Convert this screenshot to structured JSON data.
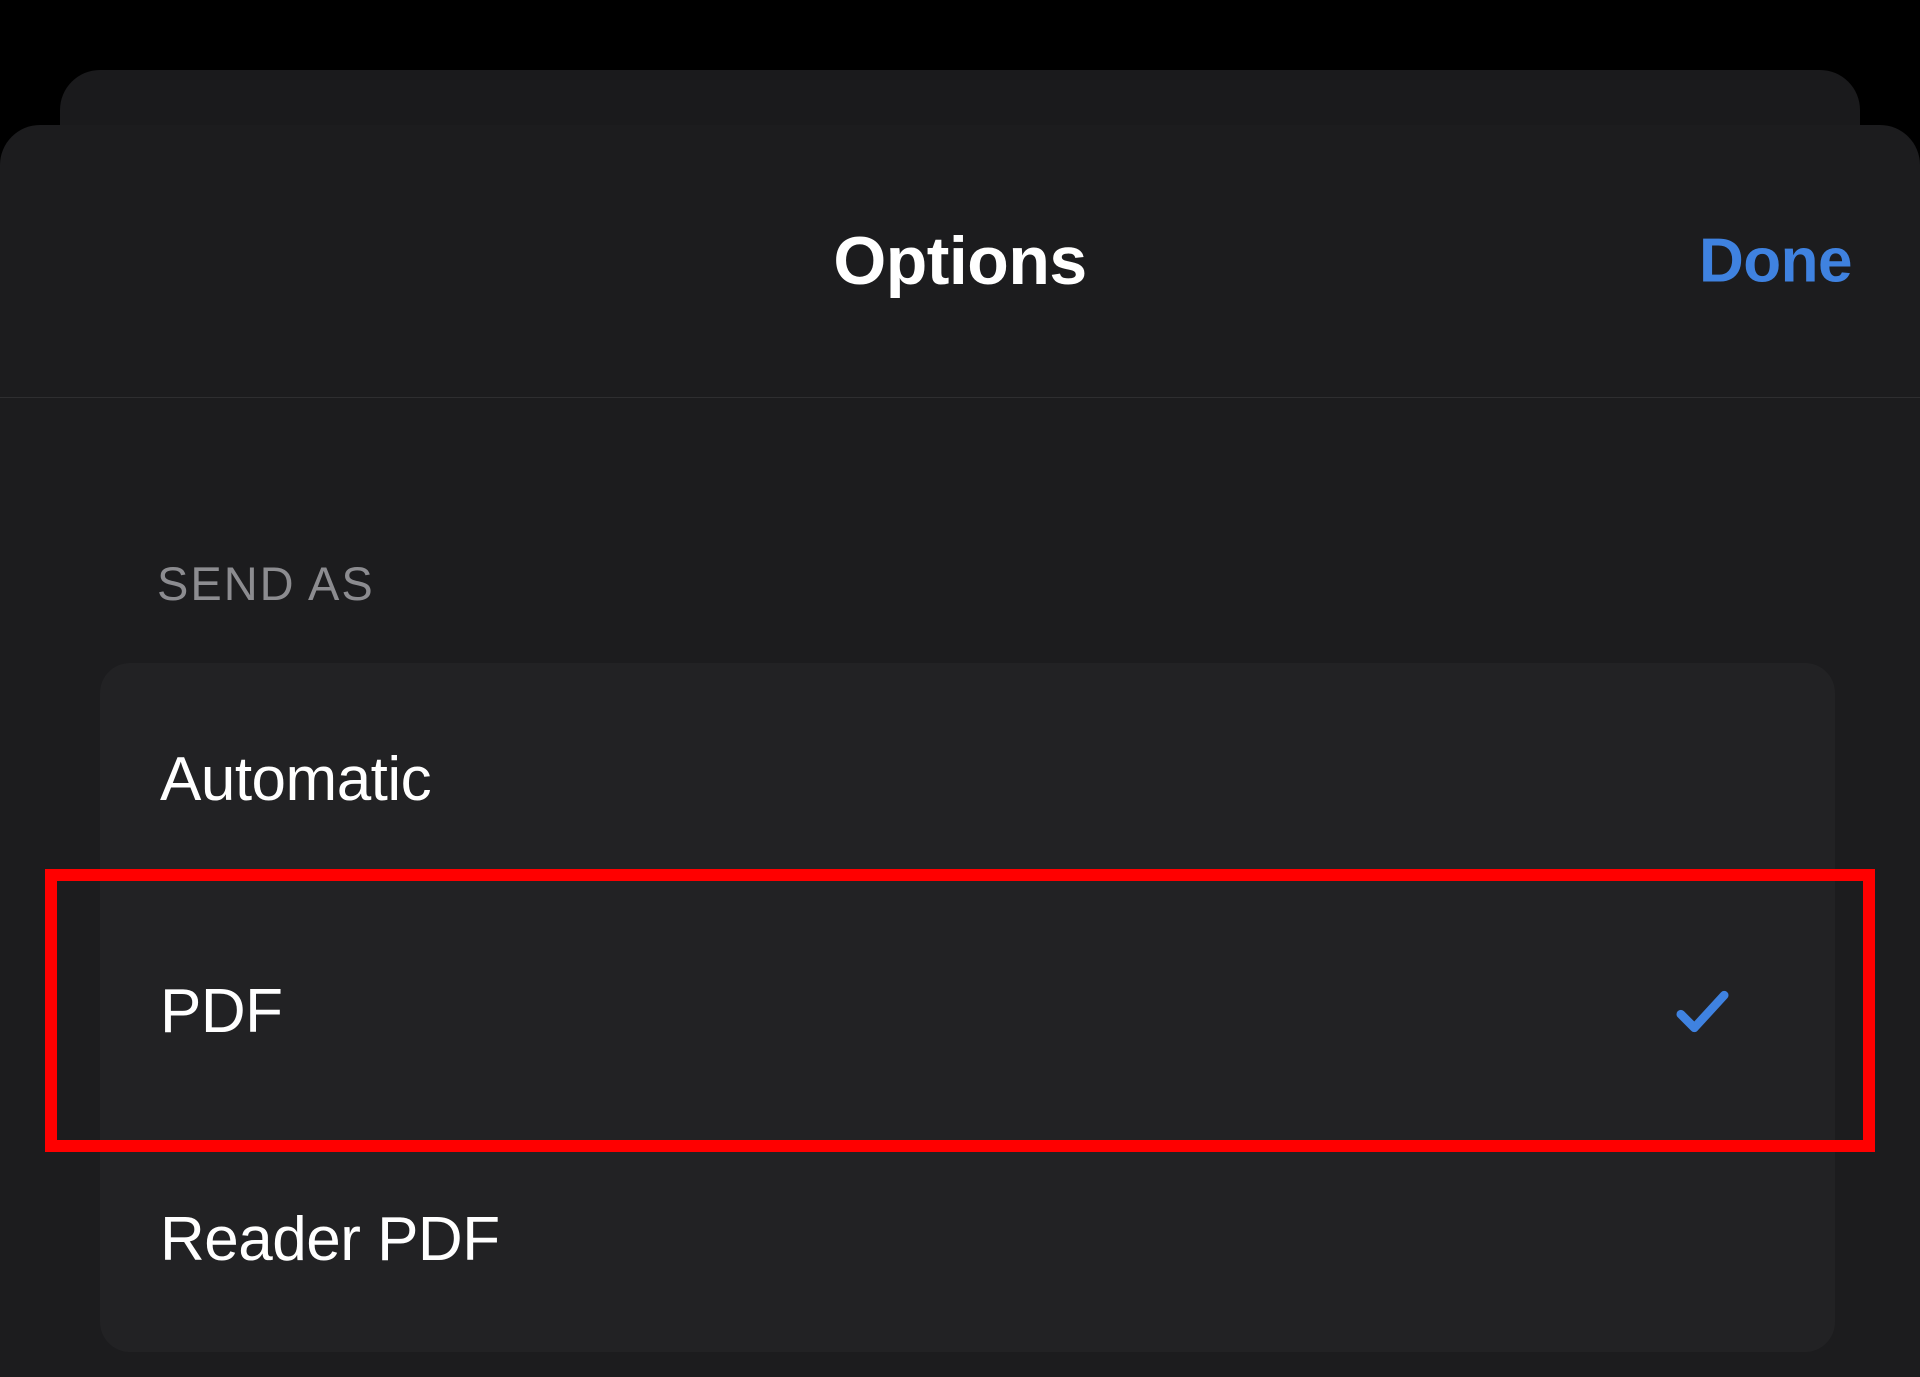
{
  "header": {
    "title": "Options",
    "done_label": "Done"
  },
  "section": {
    "header": "SEND AS",
    "items": [
      {
        "label": "Automatic",
        "selected": false,
        "highlighted": false
      },
      {
        "label": "PDF",
        "selected": true,
        "highlighted": true
      },
      {
        "label": "Reader PDF",
        "selected": false,
        "highlighted": false
      }
    ]
  },
  "colors": {
    "accent": "#3f82e0",
    "highlight": "#ff0000"
  }
}
